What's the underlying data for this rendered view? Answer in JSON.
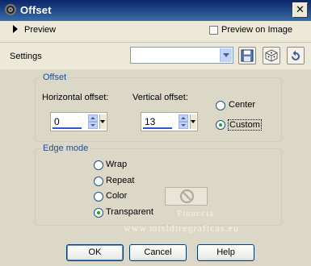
{
  "window": {
    "title": "Offset",
    "close_glyph": "✕"
  },
  "preview": {
    "label": "Preview",
    "preview_on_image_label": "Preview on Image",
    "preview_on_image_checked": false
  },
  "settings": {
    "label": "Settings",
    "value": ""
  },
  "offset": {
    "title": "Offset",
    "horizontal_label": "Horizontal offset:",
    "horizontal_value": "0",
    "vertical_label": "Vertical offset:",
    "vertical_value": "13",
    "center_label": "Center",
    "custom_label": "Custom",
    "selected": "custom"
  },
  "edge_mode": {
    "title": "Edge mode",
    "options": [
      "Wrap",
      "Repeat",
      "Color",
      "Transparent"
    ],
    "selected": "Transparent"
  },
  "watermark": {
    "line1": "Pinuccia",
    "line2": "www.misldiregraficas.eu"
  },
  "buttons": {
    "ok": "OK",
    "cancel": "Cancel",
    "help": "Help"
  },
  "colors": {
    "titlebar": "#0a246a",
    "accent": "#1c4fa0",
    "radio_dot": "#21a121",
    "slider": "#2d56c8"
  },
  "icons": {
    "app": "pattern-icon",
    "save": "floppy-disk-icon",
    "randomize": "dice-icon",
    "reset": "reset-icon",
    "no_color": "no-symbol-icon"
  }
}
